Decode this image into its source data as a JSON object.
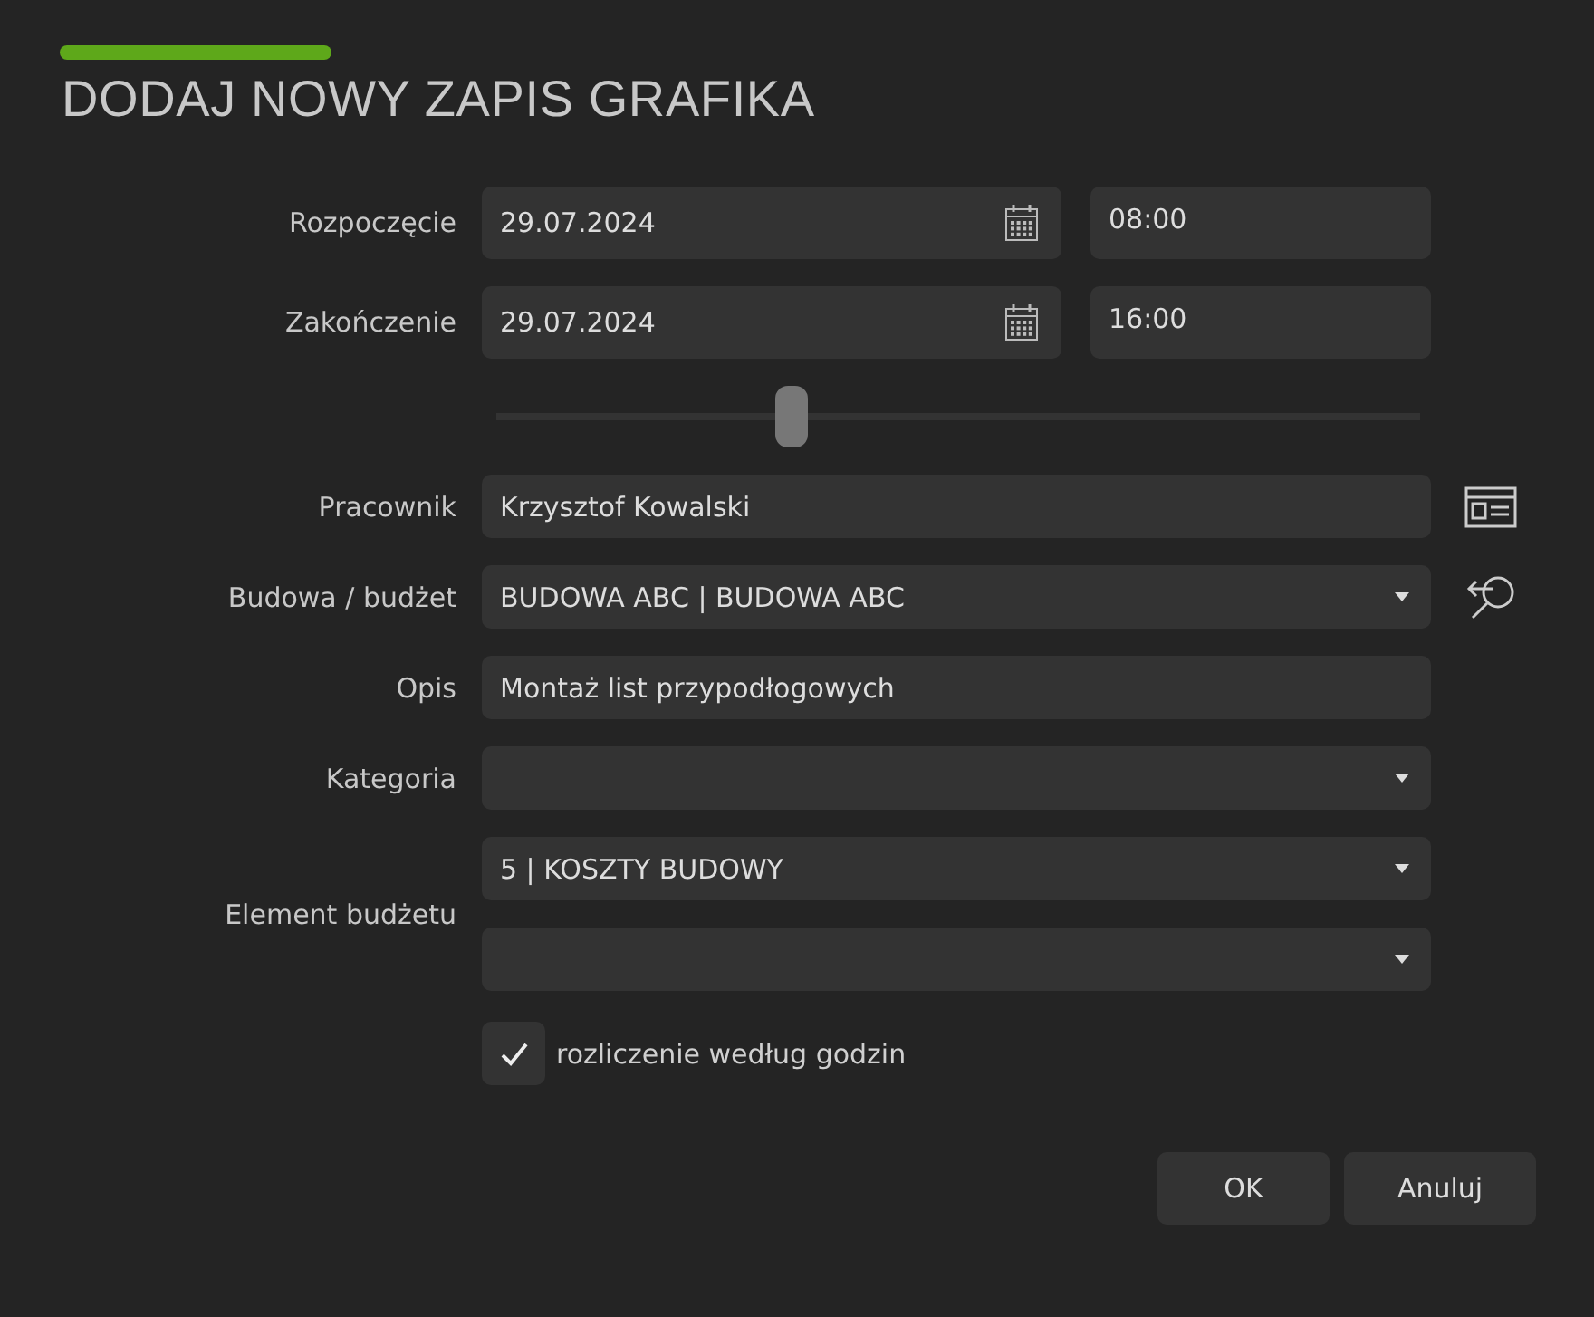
{
  "title": "DODAJ NOWY ZAPIS GRAFIKA",
  "datetimes": [
    {
      "label": "Rozpoczęcie",
      "date": "29.07.2024",
      "time": "08:00"
    },
    {
      "label": "Zakończenie",
      "date": "29.07.2024",
      "time": "16:00"
    }
  ],
  "slider": {
    "level": 0.32
  },
  "fields": [
    {
      "label": "Pracownik",
      "kind": "text",
      "value": "Krzysztof Kowalski",
      "side_button": {
        "kind": "card"
      }
    },
    {
      "label": "Budowa / budżet",
      "kind": "select",
      "value": "BUDOWA ABC | BUDOWA ABC",
      "side_button": {
        "kind": "lookup"
      }
    },
    {
      "label": "Opis",
      "kind": "text",
      "value": "Montaż list przypodłogowych"
    },
    {
      "label": "Kategoria",
      "kind": "select"
    }
  ],
  "budget_element": {
    "label": "Element budżetu",
    "selects": [
      {
        "kind": "select",
        "value": "5 | KOSZTY BUDOWY"
      },
      {
        "kind": "select"
      }
    ]
  },
  "hourly": {
    "label": "rozliczenie według godzin",
    "checked": true
  },
  "buttons": [
    "OK",
    "Anuluj"
  ]
}
